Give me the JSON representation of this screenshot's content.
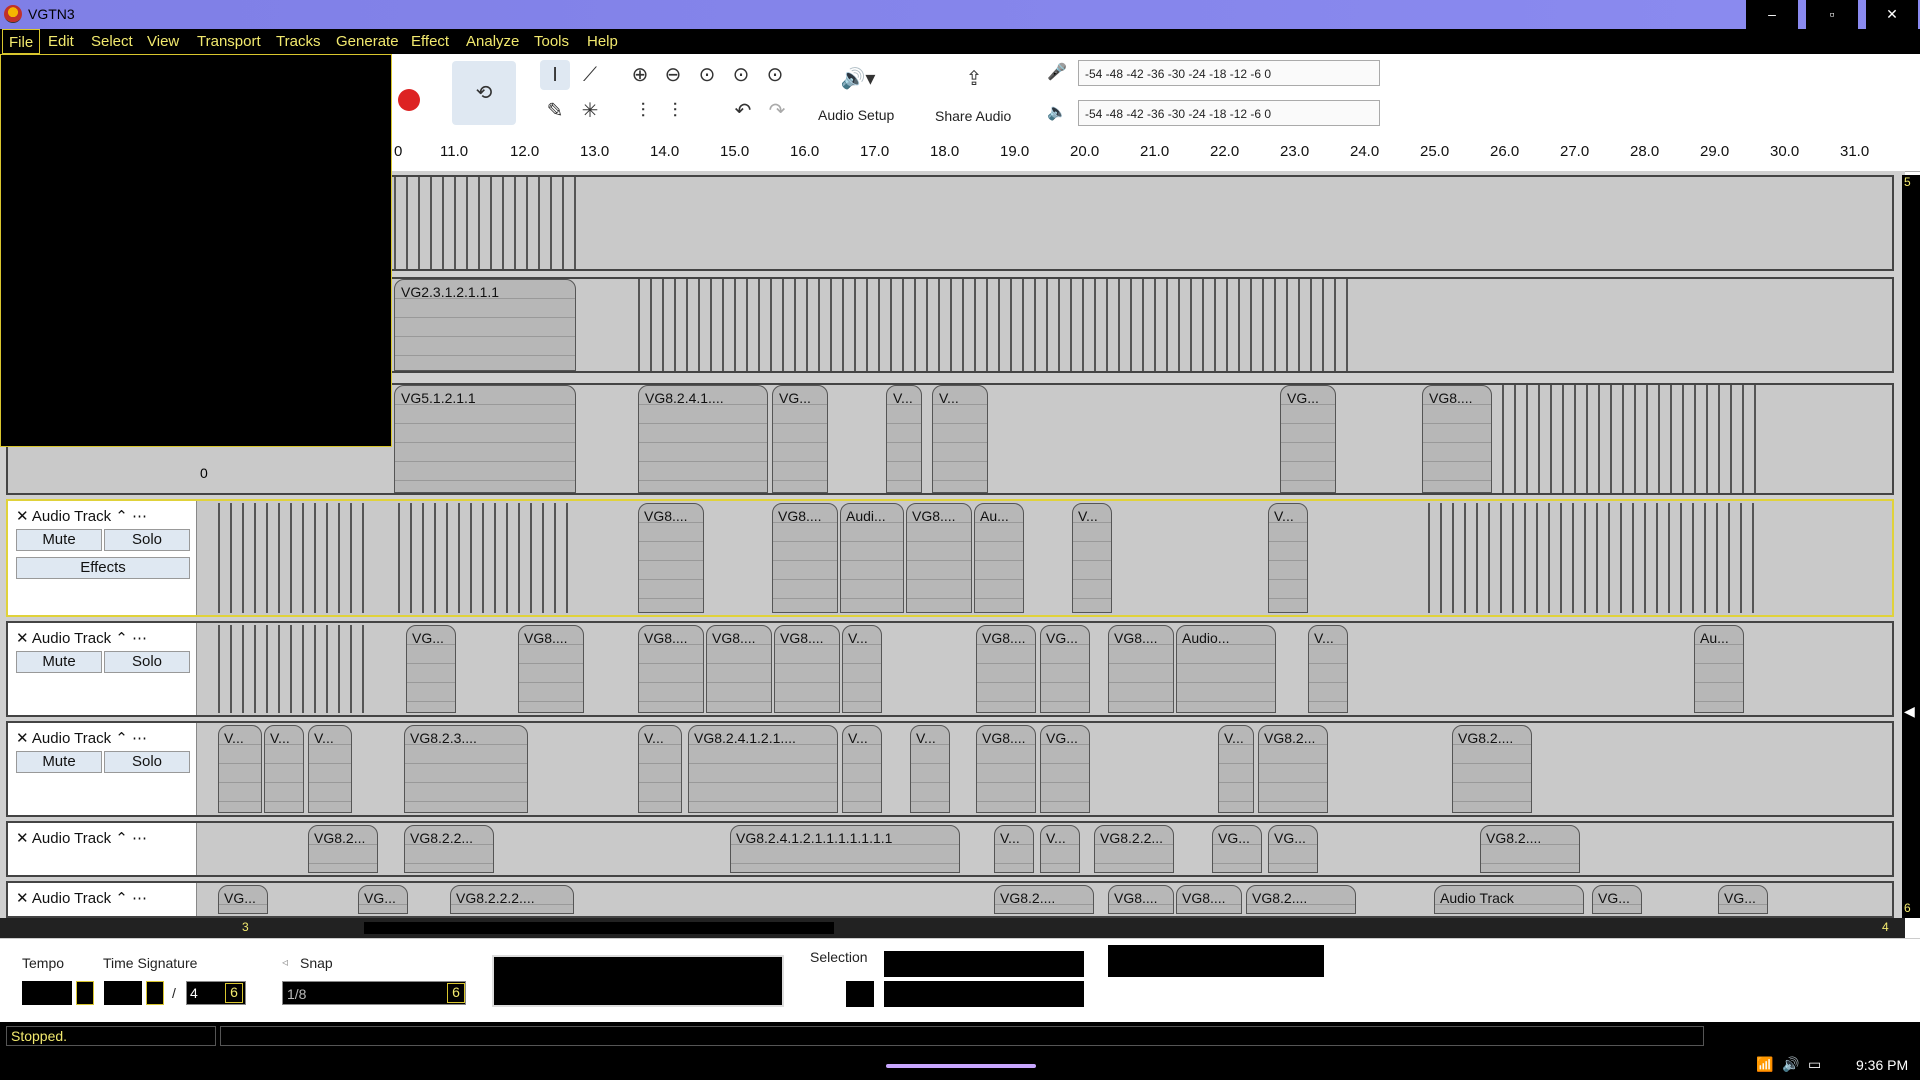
{
  "window": {
    "title": "VGTN3",
    "minimize": "–",
    "maximize": "▫",
    "close": "✕"
  },
  "menu": [
    "File",
    "Edit",
    "Select",
    "View",
    "Transport",
    "Tracks",
    "Generate",
    "Effect",
    "Analyze",
    "Tools",
    "Help"
  ],
  "toolbar": {
    "audio_setup": "Audio Setup",
    "share_audio": "Share Audio",
    "meter_scale": "-54  -48  -42  -36  -30  -24  -18  -12   -6   0"
  },
  "ruler": [
    "0",
    "11.0",
    "12.0",
    "13.0",
    "14.0",
    "15.0",
    "16.0",
    "17.0",
    "18.0",
    "19.0",
    "20.0",
    "21.0",
    "22.0",
    "23.0",
    "24.0",
    "25.0",
    "26.0",
    "27.0",
    "28.0",
    "29.0",
    "30.0",
    "31.0"
  ],
  "tracks": [
    {
      "name": "Audio Track",
      "mute": "Mute",
      "solo": "Solo",
      "effects": "Effects",
      "clips": [
        "VG8....",
        "VG8....",
        "Audi...",
        "VG8....",
        "Au...",
        "V...",
        "V..."
      ]
    },
    {
      "name": "Audio Track",
      "mute": "Mute",
      "solo": "Solo",
      "clips": [
        "VG...",
        "VG8....",
        "VG8....",
        "VG8....",
        "VG8....",
        "V...",
        "VG8....",
        "VG...",
        "VG8....",
        "Audio...",
        "V...",
        "Au..."
      ]
    },
    {
      "name": "Audio Track",
      "mute": "Mute",
      "solo": "Solo",
      "clips": [
        "V...",
        "V...",
        "V...",
        "VG8.2.3....",
        "V...",
        "VG8.2.4.1.2.1....",
        "V...",
        "V...",
        "VG8....",
        "VG...",
        "V...",
        "VG8.2...",
        "VG8.2...."
      ]
    },
    {
      "name": "Audio Track",
      "clips": [
        "VG8.2...",
        "VG8.2.2...",
        "VG8.2.4.1.2.1.1.1.1.1.1.1",
        "V...",
        "V...",
        "VG8.2.2...",
        "VG...",
        "VG...",
        "VG8.2...."
      ]
    },
    {
      "name": "Audio Track",
      "clips": [
        "VG...",
        "VG...",
        "VG8.2.2.2....",
        "VG8.2....",
        "VG8....",
        "VG8....",
        "VG8.2....",
        "Audio Track",
        "VG...",
        "VG..."
      ]
    }
  ],
  "upper_clips": [
    "VG2.3.1.2.1.1.1",
    "VG5.1.2.1.1",
    "VG8.2.4.1....",
    "VG...",
    "V...",
    "V...",
    "VG...",
    "VG8...."
  ],
  "track_zero": "0",
  "scroll_markers": {
    "left": "3",
    "right": "4",
    "top": "5",
    "bottom": "6"
  },
  "bottom": {
    "tempo_label": "Tempo",
    "timesig_label": "Time Signature",
    "timesig_sep": "/",
    "timesig_den": "4",
    "spin_badge": "6",
    "snap_label": "Snap",
    "snap_value": "1/8",
    "selection_label": "Selection"
  },
  "status": {
    "text": "Stopped."
  },
  "taskbar": {
    "time": "9:36 PM"
  }
}
